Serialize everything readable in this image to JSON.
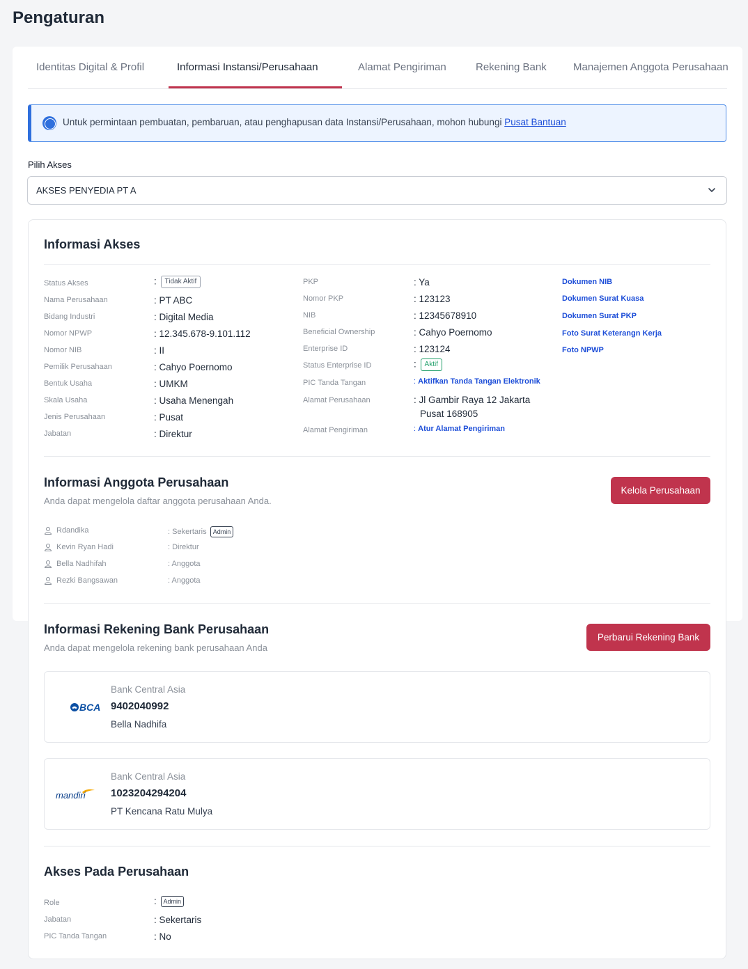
{
  "page": {
    "title": "Pengaturan"
  },
  "tabs": [
    {
      "label": "Identitas Digital & Profil"
    },
    {
      "label": "Informasi Instansi/Perusahaan"
    },
    {
      "label": "Alamat Pengiriman"
    },
    {
      "label": "Rekening Bank"
    },
    {
      "label": "Manajemen Anggota Perusahaan"
    }
  ],
  "banner": {
    "text": "Untuk permintaan pembuatan, pembaruan, atau penghapusan data Instansi/Perusahaan, mohon hubungi ",
    "link": "Pusat Bantuan",
    "icon": "info-icon"
  },
  "access_select": {
    "label": "Pilih Akses",
    "value": "AKSES PENYEDIA PT A"
  },
  "info_akses": {
    "title": "Informasi Akses",
    "left": [
      {
        "label": "Status Akses",
        "value": "Tidak Aktif"
      },
      {
        "label": "Nama Perusahaan",
        "value": ": PT ABC"
      },
      {
        "label": "Bidang Industri",
        "value": ": Digital Media"
      },
      {
        "label": "Nomor NPWP",
        "value": ": 12.345.678-9.101.112"
      },
      {
        "label": "Nomor NIB",
        "value": ": II"
      },
      {
        "label": "Pemilik Perusahaan",
        "value": ": Cahyo Poernomo"
      },
      {
        "label": "Bentuk Usaha",
        "value": ": UMKM"
      },
      {
        "label": "Skala Usaha",
        "value": ": Usaha Menengah"
      },
      {
        "label": "Jenis Perusahaan",
        "value": ": Pusat"
      },
      {
        "label": "Jabatan",
        "value": ": Direktur"
      }
    ],
    "right": [
      {
        "label": "PKP",
        "value": ": Ya"
      },
      {
        "label": "Nomor PKP",
        "value": ": 123123"
      },
      {
        "label": "NIB",
        "value": ": 12345678910"
      },
      {
        "label": "Beneficial Ownership",
        "value": ": Cahyo Poernomo"
      },
      {
        "label": "Enterprise ID",
        "value": ": 123124"
      },
      {
        "label": "Status Enterprise ID",
        "value": "Aktif"
      },
      {
        "label": "PIC Tanda Tangan",
        "value": "Aktifkan Tanda Tangan Elektronik"
      },
      {
        "label": "Alamat Perusahaan",
        "value": ": Jl Gambir Raya 12 Jakarta",
        "value2": "Pusat 168905"
      },
      {
        "label": "Alamat Pengiriman",
        "value": "Atur Alamat Pengiriman"
      }
    ],
    "colon": ":",
    "documents": [
      "Dokumen NIB",
      "Dokumen Surat Kuasa",
      "Dokumen Surat PKP",
      "Foto Surat Keterangn Kerja",
      "Foto NPWP"
    ]
  },
  "anggota": {
    "title": "Informasi Anggota Perusahaan",
    "subtitle": "Anda dapat mengelola daftar anggota perusahaan Anda.",
    "button": "Kelola Perusahaan",
    "members": [
      {
        "name": "Rdandika",
        "role": ": Sekertaris",
        "badge": "Admin"
      },
      {
        "name": "Kevin Ryan Hadi",
        "role": ": Direktur"
      },
      {
        "name": "Bella Nadhifah",
        "role": ": Anggota"
      },
      {
        "name": "Rezki Bangsawan",
        "role": ": Anggota"
      }
    ]
  },
  "rekening": {
    "title": "Informasi Rekening Bank Perusahaan",
    "subtitle": "Anda dapat mengelola rekening bank perusahaan Anda",
    "button": "Perbarui Rekening Bank",
    "banks": [
      {
        "logo": "BCA",
        "bank": "Bank Central Asia",
        "number": "9402040992",
        "holder": "Bella Nadhifa"
      },
      {
        "logo": "mandiri",
        "bank": "Bank Central Asia",
        "number": "1023204294204",
        "holder": "PT Kencana Ratu Mulya"
      }
    ]
  },
  "akses_perusahaan": {
    "title": "Akses Pada Perusahaan",
    "rows": [
      {
        "label": "Role",
        "value": "Admin"
      },
      {
        "label": "Jabatan",
        "value": ": Sekertaris"
      },
      {
        "label": "PIC Tanda Tangan",
        "value": ": No"
      }
    ]
  },
  "colors": {
    "accent": "#c0344d",
    "link": "#1d4ed8",
    "info": "#2f6fdd",
    "success": "#22a06b"
  }
}
